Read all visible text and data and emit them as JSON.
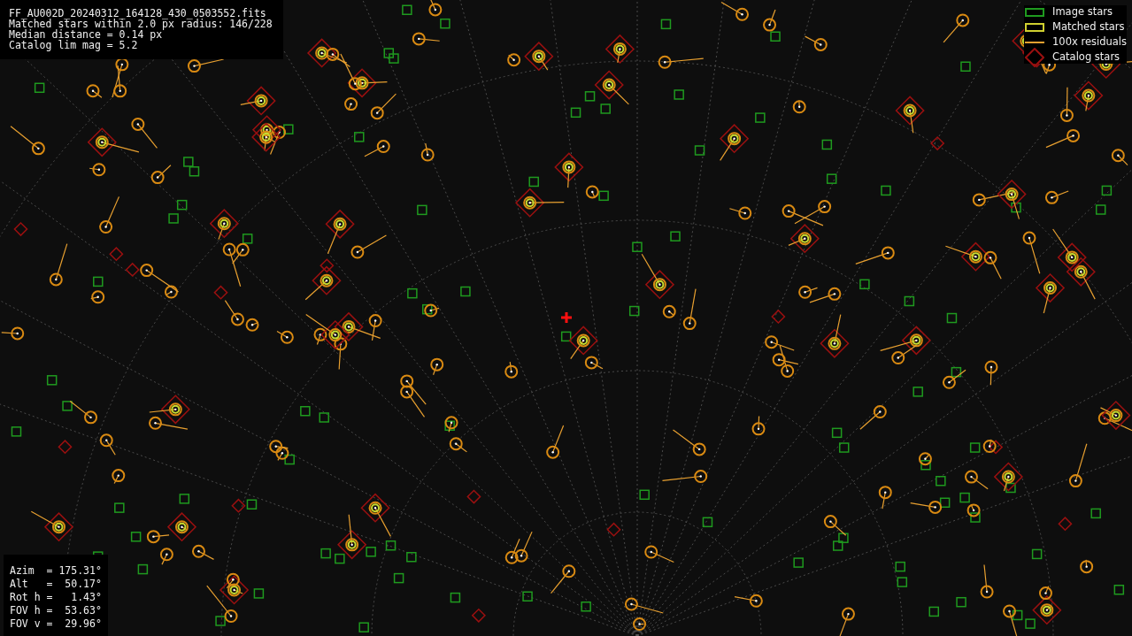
{
  "info": {
    "lines": [
      "FF_AU002D_20240312_164128_430_0503552.fits",
      "Matched stars within 2.0 px radius: 146/228",
      "Median distance = 0.14 px",
      "Catalog lim mag = 5.2"
    ]
  },
  "legend": [
    {
      "kind": "image",
      "label": "Image stars"
    },
    {
      "kind": "matched",
      "label": "Matched stars"
    },
    {
      "kind": "residual",
      "label": "100x residuals"
    },
    {
      "kind": "catalog",
      "label": "Catalog stars"
    }
  ],
  "pointing": {
    "lines": [
      "Azim  = 175.31°",
      "Alt   =  50.17°",
      "Rot h =   1.43°",
      "FOV h =  53.63°",
      "FOV v =  29.96°"
    ]
  }
}
